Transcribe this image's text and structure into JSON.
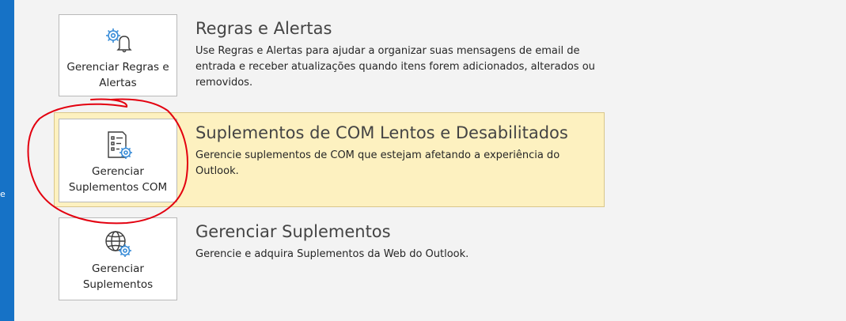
{
  "sections": [
    {
      "tile_label": "Gerenciar Regras e\nAlertas",
      "icon": "gear-bell-icon",
      "heading": "Regras e Alertas",
      "description_lines": [
        "Use Regras e Alertas para ajudar a organizar suas mensagens de email de",
        "entrada e receber atualizações quando itens forem adicionados, alterados ou",
        "removidos."
      ]
    },
    {
      "tile_label": "Gerenciar\nSuplementos COM",
      "icon": "checklist-gear-icon",
      "heading": "Suplementos de COM Lentos e Desabilitados",
      "description_lines": [
        "Gerencie suplementos de COM que estejam afetando a experiência do",
        "Outlook."
      ],
      "highlighted": true
    },
    {
      "tile_label": "Gerenciar\nSuplementos",
      "icon": "globe-gear-icon",
      "heading": "Gerenciar Suplementos",
      "description_lines": [
        "Gerencie e adquira Suplementos da Web do Outlook."
      ]
    }
  ],
  "left_rail": {
    "letter": "e",
    "color": "#1672c6"
  },
  "colors": {
    "highlight_bg": "#fdf1c0",
    "icon_blue": "#3a8dd8",
    "annotation_red": "#e3000f"
  }
}
